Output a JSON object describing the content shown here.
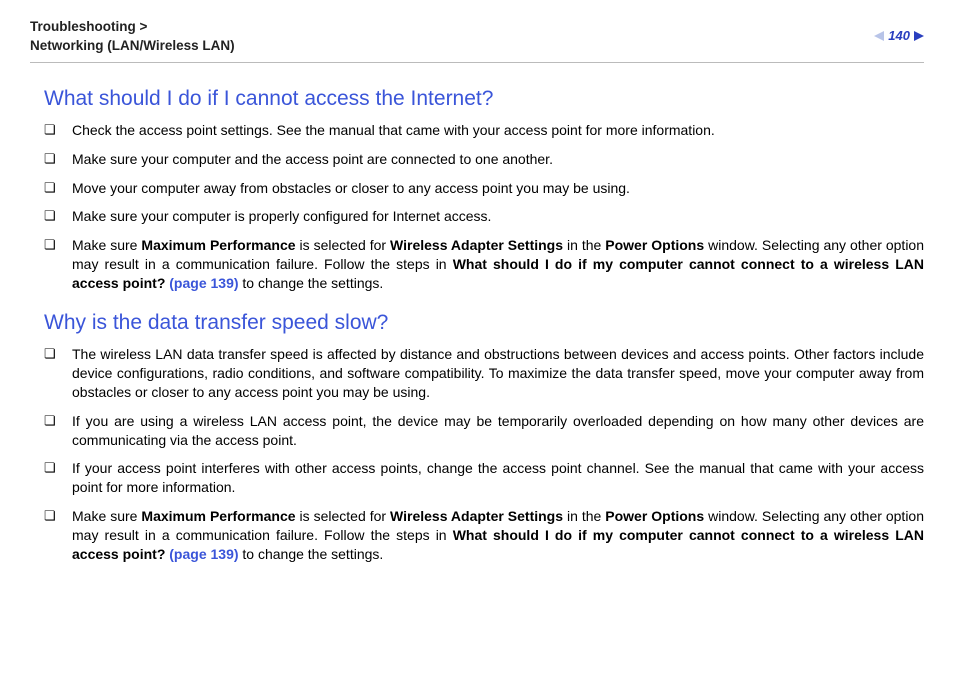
{
  "header": {
    "breadcrumb_line1": "Troubleshooting >",
    "breadcrumb_line2": "Networking (LAN/Wireless LAN)",
    "page_number": "140"
  },
  "sections": [
    {
      "heading": "What should I do if I cannot access the Internet?",
      "items": [
        {
          "text": "Check the access point settings. See the manual that came with your access point for more information."
        },
        {
          "text": "Make sure your computer and the access point are connected to one another."
        },
        {
          "text": "Move your computer away from obstacles or closer to any access point you may be using."
        },
        {
          "text": "Make sure your computer is properly configured for Internet access."
        },
        {
          "pre": "Make sure ",
          "b1": "Maximum Performance",
          "mid1": " is selected for ",
          "b2": "Wireless Adapter Settings",
          "mid2": " in the ",
          "b3": "Power Options",
          "mid3": " window. Selecting any other option may result in a communication failure. Follow the steps in ",
          "b4": "What should I do if my computer cannot connect to a wireless LAN access point? ",
          "link": "(page 139)",
          "post": " to change the settings."
        }
      ]
    },
    {
      "heading": "Why is the data transfer speed slow?",
      "items": [
        {
          "text": "The wireless LAN data transfer speed is affected by distance and obstructions between devices and access points. Other factors include device configurations, radio conditions, and software compatibility. To maximize the data transfer speed, move your computer away from obstacles or closer to any access point you may be using."
        },
        {
          "text": "If you are using a wireless LAN access point, the device may be temporarily overloaded depending on how many other devices are communicating via the access point."
        },
        {
          "text": "If your access point interferes with other access points, change the access point channel. See the manual that came with your access point for more information."
        },
        {
          "pre": "Make sure ",
          "b1": "Maximum Performance",
          "mid1": " is selected for ",
          "b2": "Wireless Adapter Settings",
          "mid2": " in the ",
          "b3": "Power Options",
          "mid3": " window. Selecting any other option may result in a communication failure. Follow the steps in ",
          "b4": "What should I do if my computer cannot connect to a wireless LAN access point? ",
          "link": "(page 139)",
          "post": " to change the settings."
        }
      ]
    }
  ]
}
